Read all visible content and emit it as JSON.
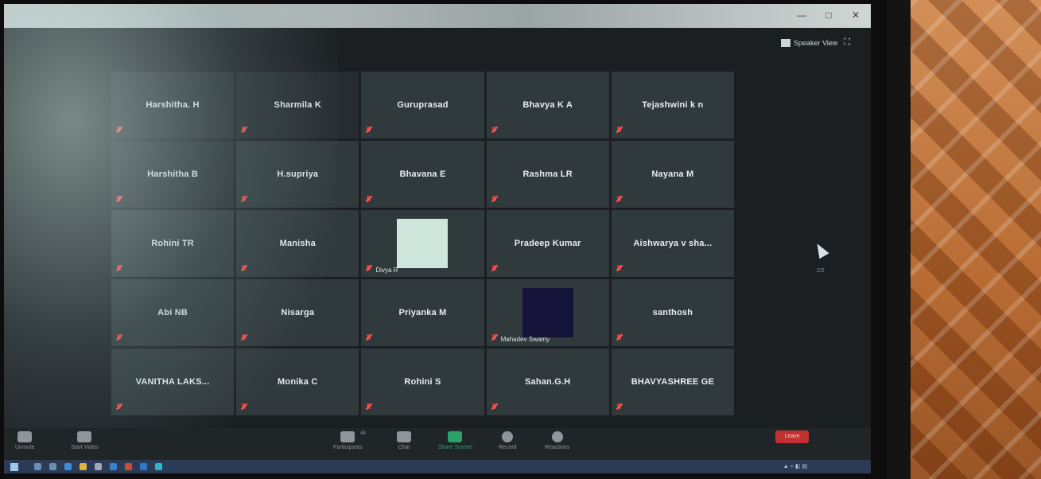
{
  "titlebar": {
    "controls": [
      "—",
      "□",
      "✕"
    ]
  },
  "view": {
    "speaker_view_label": "Speaker View"
  },
  "participants_grid": [
    {
      "name": "Harshitha. H",
      "dim": true
    },
    {
      "name": "Sharmila K",
      "dim": true
    },
    {
      "name": "Guruprasad"
    },
    {
      "name": "Bhavya K A"
    },
    {
      "name": "Tejashwini k n"
    },
    {
      "name": "Harshitha B",
      "dim": true
    },
    {
      "name": "H.supriya"
    },
    {
      "name": "Bhavana E"
    },
    {
      "name": "Rashma LR"
    },
    {
      "name": "Nayana M"
    },
    {
      "name": "Rohini TR"
    },
    {
      "name": "Manisha"
    },
    {
      "name": "Divya R",
      "video": "light"
    },
    {
      "name": "Pradeep Kumar"
    },
    {
      "name": "Aishwarya v sha..."
    },
    {
      "name": "Abi NB"
    },
    {
      "name": "Nisarga"
    },
    {
      "name": "Priyanka M"
    },
    {
      "name": "Mahadev Swamy",
      "video": "dark"
    },
    {
      "name": "santhosh"
    },
    {
      "name": "VANITHA LAKS..."
    },
    {
      "name": "Monika C"
    },
    {
      "name": "Rohini S"
    },
    {
      "name": "Sahan.G.H"
    },
    {
      "name": "BHAVYASHREE GE"
    }
  ],
  "page_indicator": "2/2",
  "toolbar": {
    "unmute": "Unmute",
    "start_video": "Start Video",
    "participants": "Participants",
    "participants_count": "48",
    "chat": "Chat",
    "share_screen": "Share Screen",
    "record": "Record",
    "reactions": "Reactions",
    "leave": "Leave"
  },
  "colors": {
    "accent_green": "#2aa36a",
    "leave_red": "#c0322f",
    "mute_red": "#d23a3a"
  }
}
